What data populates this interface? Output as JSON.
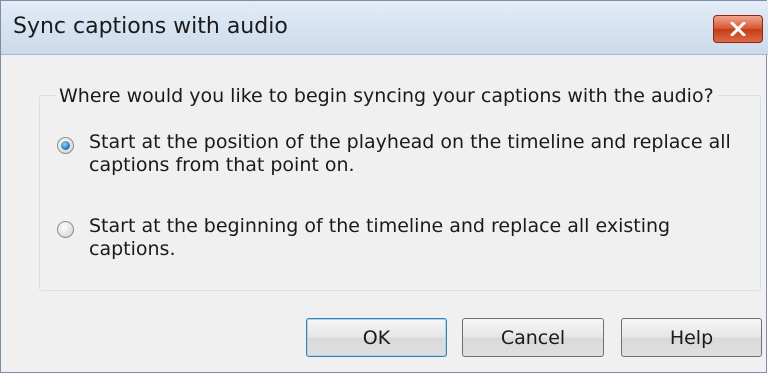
{
  "dialog": {
    "title": "Sync captions with audio",
    "close_icon": "close-icon",
    "close_color": "#d6552f"
  },
  "group": {
    "label": "Where would you like to begin syncing your captions with the audio?"
  },
  "options": [
    {
      "label": "Start at the position of the playhead on the timeline and replace all captions from that point on.",
      "checked": true
    },
    {
      "label": "Start at the beginning of the timeline and replace all existing captions.",
      "checked": false
    }
  ],
  "buttons": {
    "ok": "OK",
    "cancel": "Cancel",
    "help": "Help"
  }
}
